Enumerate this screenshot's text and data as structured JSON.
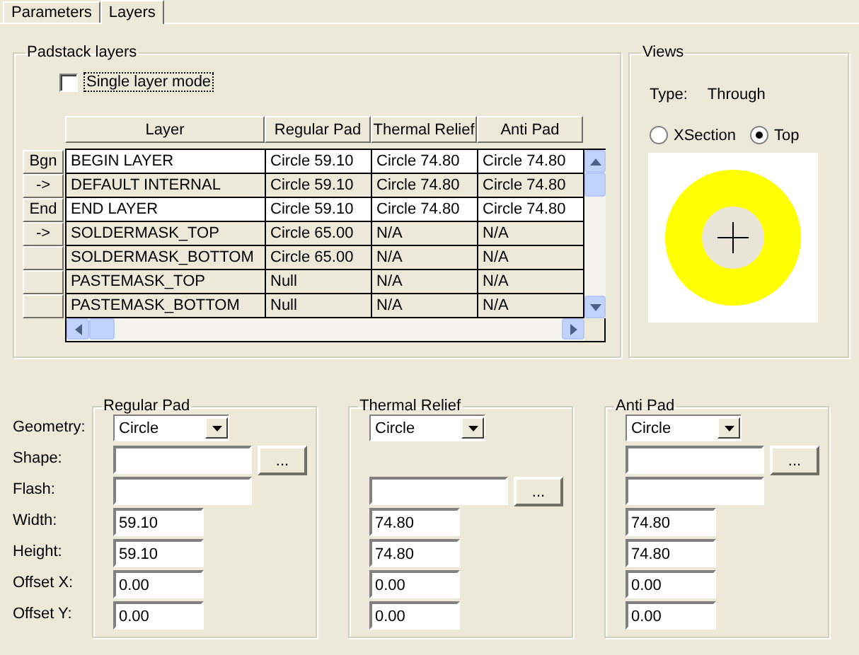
{
  "tabs": [
    {
      "label": "Parameters",
      "selected": false
    },
    {
      "label": "Layers",
      "selected": true
    }
  ],
  "padstack_layers": {
    "title": "Padstack layers",
    "single_layer_mode": {
      "label": "Single layer mode",
      "checked": false
    },
    "columns": [
      "Layer",
      "Regular Pad",
      "Thermal Relief",
      "Anti Pad"
    ],
    "rows": [
      {
        "marker": "Bgn",
        "highlighted": true,
        "cells": [
          "BEGIN LAYER",
          "Circle 59.10",
          "Circle 74.80",
          "Circle 74.80"
        ]
      },
      {
        "marker": "->",
        "highlighted": false,
        "cells": [
          "DEFAULT INTERNAL",
          "Circle 59.10",
          "Circle 74.80",
          "Circle 74.80"
        ]
      },
      {
        "marker": "End",
        "highlighted": true,
        "cells": [
          "END LAYER",
          "Circle 59.10",
          "Circle 74.80",
          "Circle 74.80"
        ]
      },
      {
        "marker": "->",
        "highlighted": false,
        "cells": [
          "SOLDERMASK_TOP",
          "Circle 65.00",
          "N/A",
          "N/A"
        ]
      },
      {
        "highlighted": false,
        "cells": [
          "SOLDERMASK_BOTTOM",
          "Circle 65.00",
          "N/A",
          "N/A"
        ]
      },
      {
        "highlighted": false,
        "cells": [
          "PASTEMASK_TOP",
          "Null",
          "N/A",
          "N/A"
        ]
      },
      {
        "highlighted": false,
        "cells": [
          "PASTEMASK_BOTTOM",
          "Null",
          "N/A",
          "N/A"
        ]
      }
    ]
  },
  "views": {
    "title": "Views",
    "type_label": "Type:",
    "type_value": "Through",
    "options": [
      {
        "label": "XSection",
        "selected": false
      },
      {
        "label": "Top",
        "selected": true
      }
    ]
  },
  "field_labels": [
    "Geometry:",
    "Shape:",
    "Flash:",
    "Width:",
    "Height:",
    "Offset X:",
    "Offset Y:"
  ],
  "pad_groups": [
    {
      "title": "Regular Pad",
      "rows": [
        {
          "kind": "select",
          "value": "Circle"
        },
        {
          "kind": "browse",
          "button": "..."
        },
        {
          "kind": "wide"
        },
        {
          "kind": "short",
          "value": "59.10"
        },
        {
          "kind": "short",
          "value": "59.10"
        },
        {
          "kind": "short",
          "value": "0.00"
        },
        {
          "kind": "short",
          "value": "0.00"
        }
      ]
    },
    {
      "title": "Thermal Relief",
      "rows": [
        {
          "kind": "select",
          "value": "Circle"
        },
        {
          "kind": "blank"
        },
        {
          "kind": "browse",
          "button": "..."
        },
        {
          "kind": "short",
          "value": "74.80"
        },
        {
          "kind": "short",
          "value": "74.80"
        },
        {
          "kind": "short",
          "value": "0.00"
        },
        {
          "kind": "short",
          "value": "0.00"
        }
      ]
    },
    {
      "title": "Anti Pad",
      "rows": [
        {
          "kind": "select",
          "value": "Circle"
        },
        {
          "kind": "browse",
          "button": "..."
        },
        {
          "kind": "wide"
        },
        {
          "kind": "short",
          "value": "74.80"
        },
        {
          "kind": "short",
          "value": "74.80"
        },
        {
          "kind": "short",
          "value": "0.00"
        },
        {
          "kind": "short",
          "value": "0.00"
        }
      ]
    }
  ]
}
